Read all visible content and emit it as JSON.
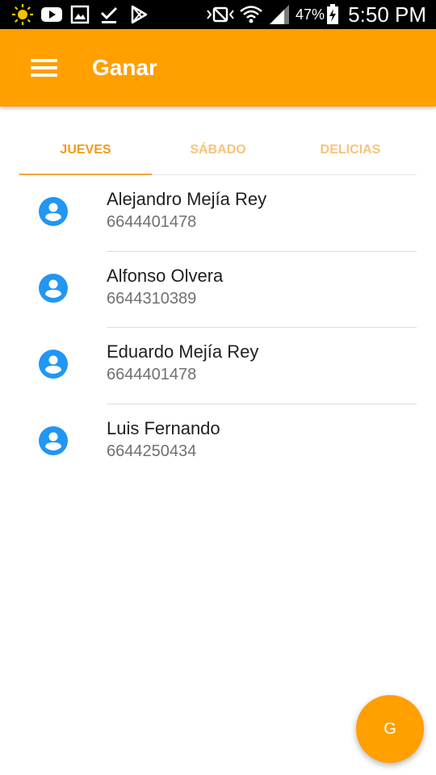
{
  "status_bar": {
    "battery_percent": "47%",
    "time": "5:50 PM",
    "icons": [
      "brightness-icon",
      "youtube-icon",
      "image-icon",
      "download-done-icon",
      "play-store-icon",
      "nfc-icon",
      "wifi-icon",
      "signal-icon",
      "battery-charging-icon"
    ]
  },
  "appbar": {
    "title": "Ganar",
    "color": "#ff9f00"
  },
  "tabs": [
    {
      "label": "JUEVES",
      "selected": true
    },
    {
      "label": "SÁBADO",
      "selected": false
    },
    {
      "label": "DELICIAS",
      "selected": false
    }
  ],
  "contacts": [
    {
      "name": "Alejandro Mejía Rey",
      "phone": "6644401478"
    },
    {
      "name": "Alfonso Olvera",
      "phone": "6644310389"
    },
    {
      "name": "Eduardo Mejía Rey",
      "phone": "6644401478"
    },
    {
      "name": "Luis Fernando",
      "phone": "6644250434"
    }
  ],
  "fab": {
    "label": "G"
  },
  "colors": {
    "accent": "#ff9f00",
    "avatar": "#2196f3"
  }
}
